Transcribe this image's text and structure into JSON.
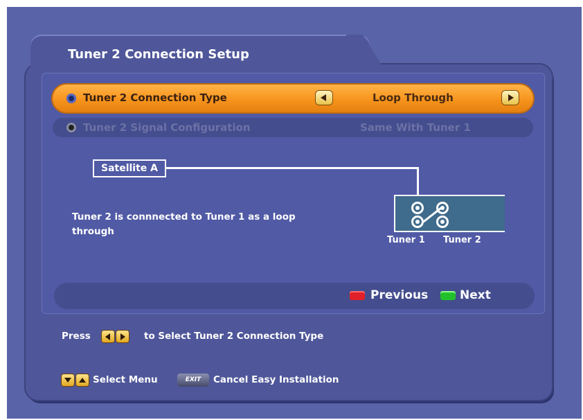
{
  "window": {
    "title": "Tuner 2 Connection Setup"
  },
  "settings": [
    {
      "label": "Tuner 2 Connection Type",
      "value": "Loop Through",
      "selected": true
    },
    {
      "label": "Tuner 2 Signal Configuration",
      "value": "Same With Tuner 1",
      "selected": false
    }
  ],
  "diagram": {
    "satellite_label": "Satellite A",
    "tuner1_label": "Tuner 1",
    "tuner2_label": "Tuner 2",
    "description": "Tuner 2 is connnected to Tuner 1 as a loop through"
  },
  "nav": {
    "previous_label": "Previous",
    "next_label": "Next",
    "previous_color": "#e0202a",
    "next_color": "#22c12c"
  },
  "hints": {
    "press_label": "Press",
    "select_type_label": "to Select Tuner 2 Connection Type",
    "select_menu_label": "Select Menu",
    "exit_key_label": "EXIT",
    "cancel_label": "Cancel Easy Installation"
  },
  "colors": {
    "accent_orange": "#f7941d",
    "background": "#5963a7"
  }
}
